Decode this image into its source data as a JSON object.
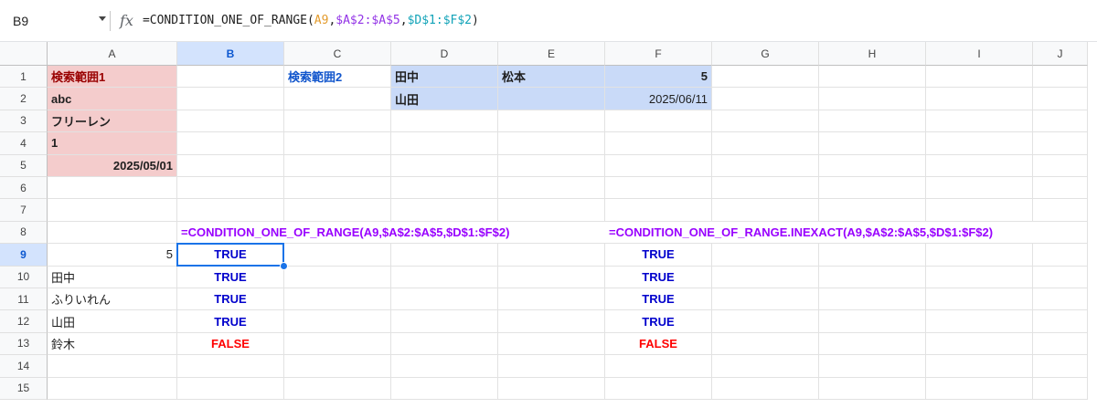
{
  "formula_bar": {
    "cell_ref": "B9",
    "formula_parts": [
      {
        "text": "=CONDITION_ONE_OF_RANGE(",
        "color": "default"
      },
      {
        "text": "A9",
        "color": "orange"
      },
      {
        "text": ",",
        "color": "default"
      },
      {
        "text": "$A$2:$A$5",
        "color": "purple"
      },
      {
        "text": ",",
        "color": "default"
      },
      {
        "text": "$D$1:$F$2",
        "color": "teal"
      },
      {
        "text": ")",
        "color": "default"
      }
    ]
  },
  "columns": [
    "A",
    "B",
    "C",
    "D",
    "E",
    "F",
    "G",
    "H",
    "I",
    "J"
  ],
  "rows": [
    "1",
    "2",
    "3",
    "4",
    "5",
    "6",
    "7",
    "8",
    "9",
    "10",
    "11",
    "12",
    "13",
    "14",
    "15"
  ],
  "selected_cell": "B9",
  "cells": {
    "A1": "検索範囲1",
    "C1": "検索範囲2",
    "D1": "田中",
    "E1": "松本",
    "F1": "5",
    "A2": "abc",
    "D2": "山田",
    "F2": "2025/06/11",
    "A3": "フリーレン",
    "A4": "1",
    "A5": "2025/05/01",
    "B8": "=CONDITION_ONE_OF_RANGE(A9,$A$2:$A$5,$D$1:$F$2)",
    "F8": "=CONDITION_ONE_OF_RANGE.INEXACT(A9,$A$2:$A$5,$D$1:$F$2)",
    "A9": "5",
    "B9": "TRUE",
    "F9": "TRUE",
    "A10": "田中",
    "B10": "TRUE",
    "F10": "TRUE",
    "A11": "ふりいれん",
    "B11": "TRUE",
    "F11": "TRUE",
    "A12": "山田",
    "B12": "TRUE",
    "F12": "TRUE",
    "A13": "鈴木",
    "B13": "FALSE",
    "F13": "FALSE"
  },
  "colors": {
    "pink_fill": "#f4cccc",
    "blue_fill": "#c9daf8",
    "selection": "#1a73e8",
    "true_text": "#0000cc",
    "false_text": "#ff0000",
    "formula_text": "#9900ff"
  }
}
